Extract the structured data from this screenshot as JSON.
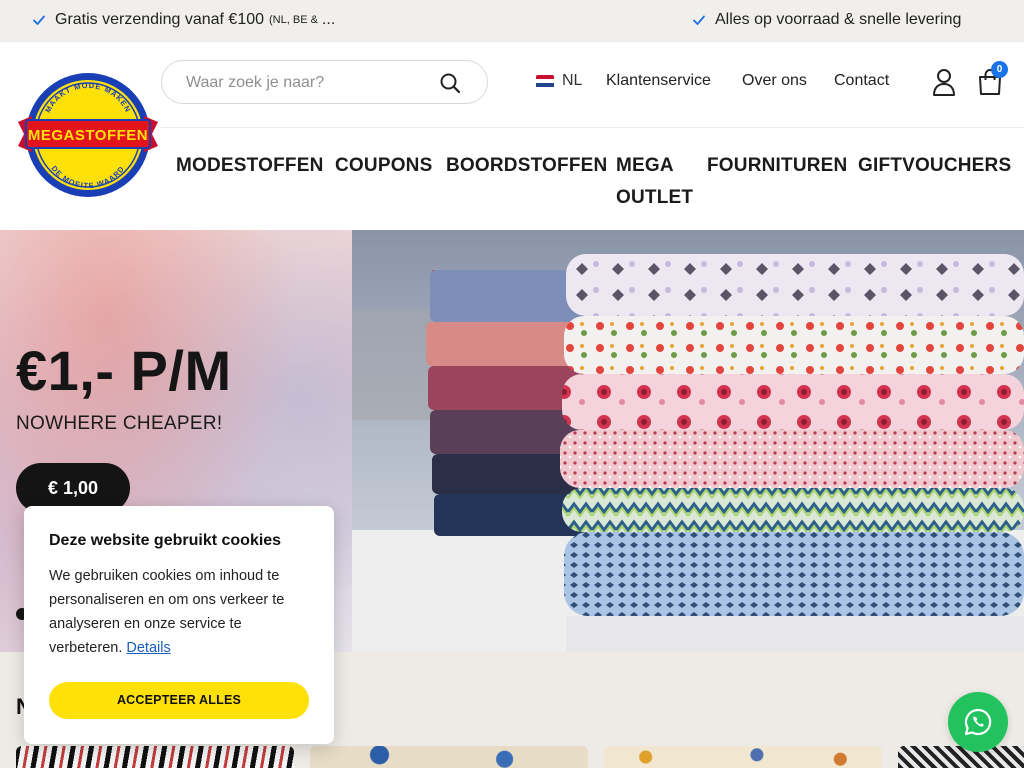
{
  "usp": [
    {
      "text": "Gratis verzending vanaf €100",
      "sup": "(NL, BE &",
      "ellipsis": "..."
    },
    {
      "text": "Alles op voorraad & snelle levering"
    }
  ],
  "brand": {
    "name": "MEGASTOFFEN",
    "tag_top": "MAAKT MODE MAKEN",
    "tag_bottom": "DE MOEITE WAARD"
  },
  "search": {
    "placeholder": "Waar zoek je naar?",
    "value": ""
  },
  "language": {
    "code": "NL"
  },
  "top_links": [
    "Klantenservice",
    "Over ons",
    "Contact"
  ],
  "cart": {
    "count": "0"
  },
  "main_nav": [
    "MODESTOFFEN",
    "COUPONS",
    "BOORDSTOFFEN",
    "MEGA OUTLET",
    "FOURNITUREN",
    "GIFTVOUCHERS"
  ],
  "hero": {
    "title": "€1,- P/M",
    "subtitle": "NOWHERE CHEAPER!",
    "price_button": "€ 1,00"
  },
  "cookie": {
    "title": "Deze website gebruikt cookies",
    "text": "We gebruiken cookies om inhoud te personaliseren en om ons verkeer te analyseren en onze service te verbeteren.",
    "details_link": "Details",
    "accept_button": "ACCEPTEER ALLES"
  },
  "section": {
    "title_partial": "N"
  },
  "colors": {
    "accent_yellow": "#ffe10a",
    "logo_blue": "#1a3fb5",
    "cart_badge": "#1a73e8",
    "whatsapp": "#22c35e",
    "usp_bar": "#f1efec",
    "check": "#1b6fe0"
  },
  "icons": [
    "check-icon",
    "search-icon",
    "flag-nl-icon",
    "user-icon",
    "cart-icon",
    "whatsapp-icon"
  ]
}
